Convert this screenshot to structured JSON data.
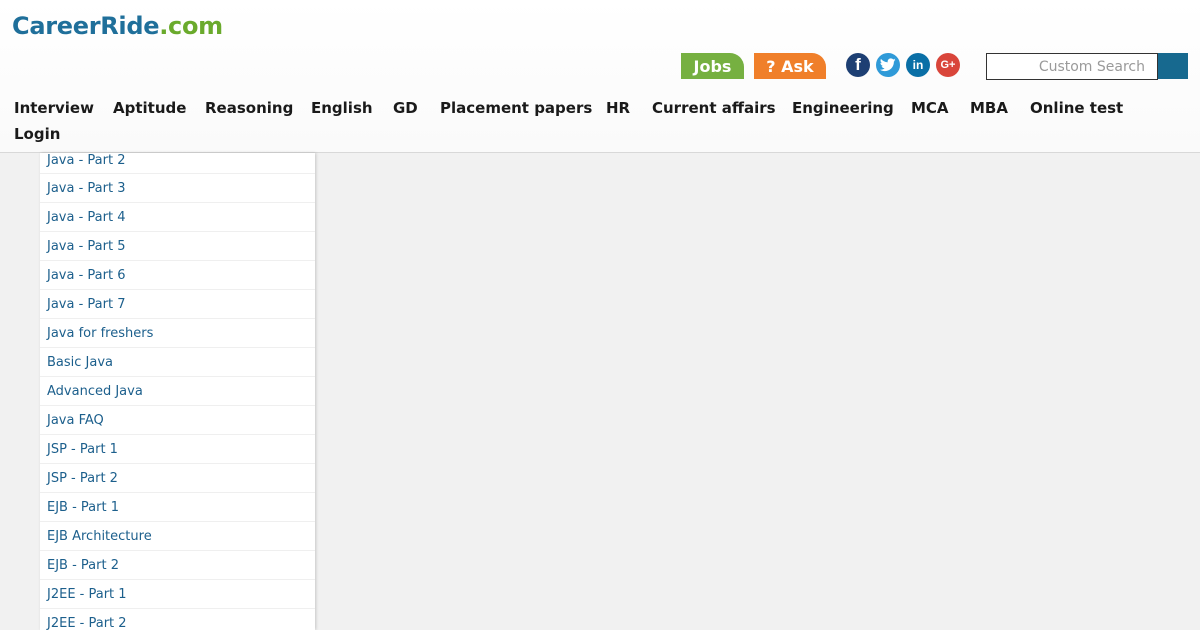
{
  "header": {
    "logo_main": "CareerRide",
    "logo_tld": ".com",
    "jobs_label": "Jobs",
    "ask_label": "? Ask",
    "social": {
      "facebook": "f",
      "twitter": "twitter-bird",
      "linkedin": "in",
      "googleplus": "G+"
    },
    "search": {
      "placeholder": "Custom Search"
    }
  },
  "nav": {
    "items": [
      "Interview",
      "Aptitude",
      "Reasoning",
      "English",
      "GD",
      "Placement papers",
      "HR",
      "Current affairs",
      "Engineering",
      "MCA",
      "MBA",
      "Online test",
      "Login"
    ]
  },
  "sidebar": {
    "items": [
      "Java - Part 2",
      "Java - Part 3",
      "Java - Part 4",
      "Java - Part 5",
      "Java - Part 6",
      "Java - Part 7",
      "Java for freshers",
      "Basic Java",
      "Advanced Java",
      "Java FAQ",
      "JSP - Part 1",
      "JSP - Part 2",
      "EJB - Part 1",
      "EJB Architecture",
      "EJB - Part 2",
      "J2EE - Part 1",
      "J2EE - Part 2"
    ]
  },
  "colors": {
    "jobs": "#76b041",
    "ask": "#f07f2a",
    "link": "#1c5f8c",
    "logo_blue": "#1f6f9a",
    "logo_green": "#6aaa2c"
  }
}
